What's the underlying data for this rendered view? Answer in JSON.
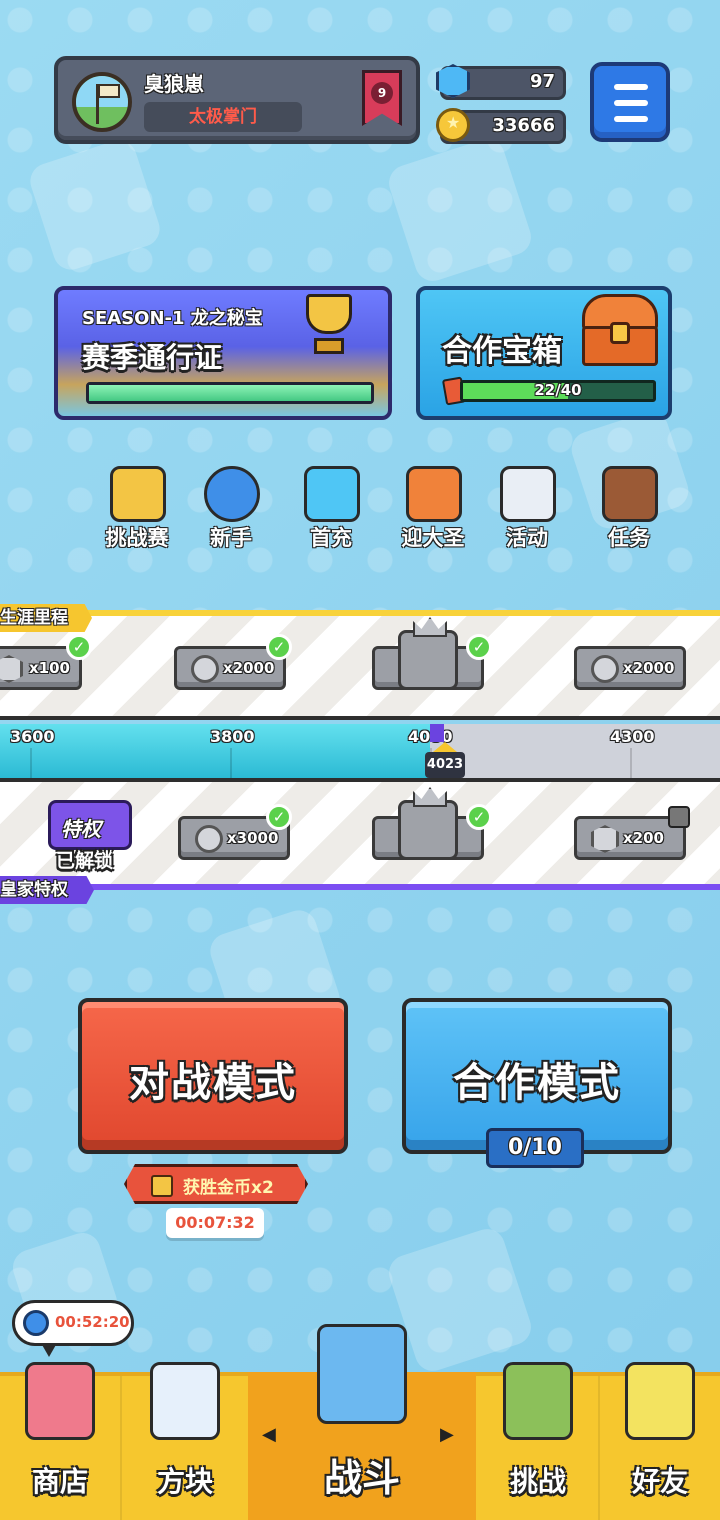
{
  "profile": {
    "name": "臭狼崽",
    "clan": "太极掌门",
    "rank": "9"
  },
  "currency": {
    "gems": "97",
    "coins": "33666"
  },
  "season": {
    "title": "SEASON-1 龙之秘宝",
    "subtitle": "赛季通行证",
    "progress": 1.0
  },
  "coop_chest": {
    "title": "合作宝箱",
    "progress_text": "22/40",
    "current": 22,
    "total": 40
  },
  "features": [
    {
      "label": "挑战赛",
      "icon": "challenge-icon",
      "color": "#f3c544"
    },
    {
      "label": "新手",
      "icon": "stopwatch-icon",
      "color": "#3f8fe8"
    },
    {
      "label": "首充",
      "icon": "gift-icon",
      "color": "#4fc6f5"
    },
    {
      "label": "迎大圣",
      "icon": "shrine-icon",
      "color": "#f0823a"
    },
    {
      "label": "活动",
      "icon": "newspaper-icon",
      "color": "#e9eef5"
    },
    {
      "label": "任务",
      "icon": "book-icon",
      "color": "#9b5a36"
    }
  ],
  "career": {
    "label": "生涯里程",
    "current_value": "4023",
    "ticks": [
      "3600",
      "3800",
      "4000",
      "4300"
    ],
    "rewards_top": [
      {
        "amount": "x100",
        "type": "hex"
      },
      {
        "amount": "x2000",
        "type": "coin"
      },
      {
        "amount": "",
        "type": "crown-box"
      },
      {
        "amount": "x2000",
        "type": "coin"
      }
    ]
  },
  "royal": {
    "label": "皇家特权",
    "privilege_label": "特权",
    "unlocked_label": "已解锁",
    "rewards_bottom": [
      {
        "amount": "x3000",
        "type": "coin"
      },
      {
        "amount": "",
        "type": "crown-box"
      },
      {
        "amount": "x200",
        "type": "hex"
      }
    ]
  },
  "modes": {
    "battle_label": "对战模式",
    "coop_label": "合作模式",
    "coop_count": "0/10",
    "bonus_label": "获胜金币x2",
    "bonus_timer": "00:07:32"
  },
  "bubble_timer": "00:52:20",
  "nav": {
    "shop": "商店",
    "blocks": "方块",
    "battle": "战斗",
    "challenge": "挑战",
    "friends": "好友"
  },
  "colors": {
    "background": "#8fd3ef",
    "battle": "#e8533c",
    "coop": "#36a3ea",
    "nav": "#f6c72e"
  }
}
